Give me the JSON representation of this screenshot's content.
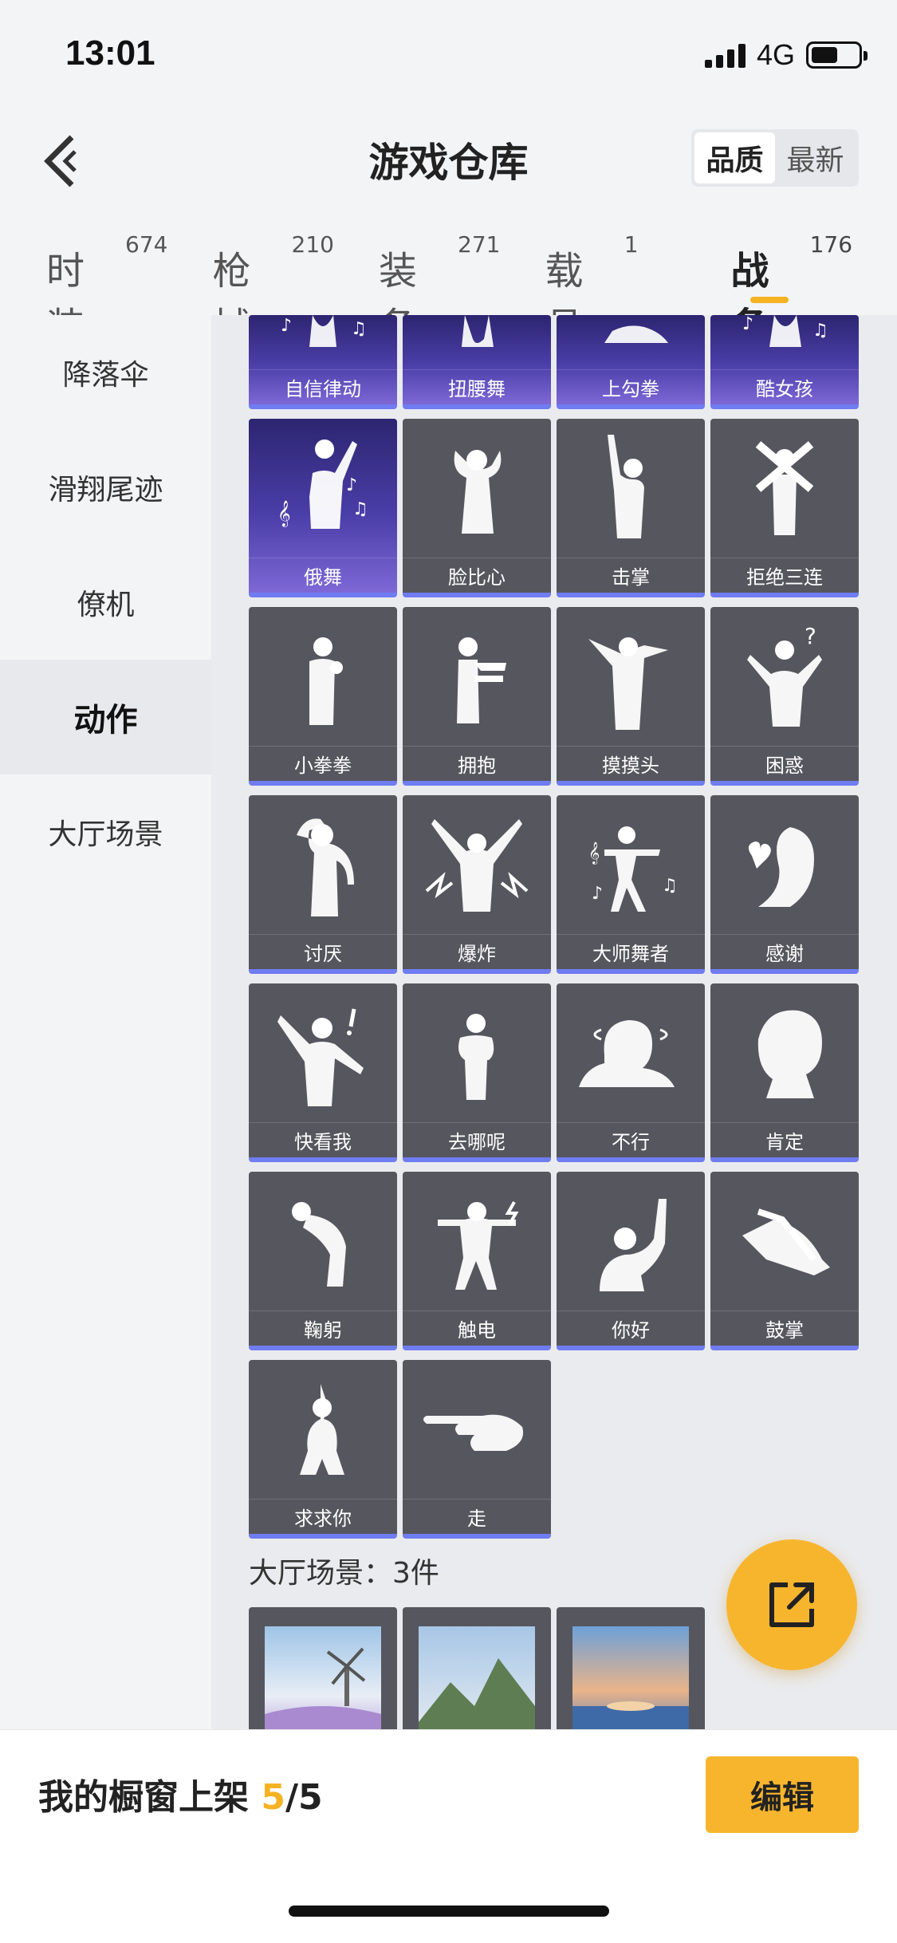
{
  "status_bar": {
    "time": "13:01",
    "network": "4G"
  },
  "header": {
    "title": "游戏仓库",
    "sort_options": [
      "品质",
      "最新"
    ],
    "active_sort": "品质"
  },
  "tabs": [
    {
      "label": "时装",
      "count": "674"
    },
    {
      "label": "枪械",
      "count": "210"
    },
    {
      "label": "装备",
      "count": "271"
    },
    {
      "label": "载具",
      "count": "1"
    },
    {
      "label": "战备",
      "count": "176"
    }
  ],
  "active_tab": "战备",
  "sidebar": {
    "items": [
      "降落伞",
      "滑翔尾迹",
      "僚机",
      "动作",
      "大厅场景"
    ],
    "active": "动作"
  },
  "actions_top_row": [
    "自信律动",
    "扭腰舞",
    "上勾拳",
    "酷女孩"
  ],
  "actions": [
    {
      "label": "俄舞",
      "icon": "dancer-music-icon",
      "rarity": "purple"
    },
    {
      "label": "脸比心",
      "icon": "heart-hands-icon",
      "rarity": "gray"
    },
    {
      "label": "击掌",
      "icon": "high-five-icon",
      "rarity": "gray"
    },
    {
      "label": "拒绝三连",
      "icon": "cross-arms-icon",
      "rarity": "gray"
    },
    {
      "label": "小拳拳",
      "icon": "fist-icon",
      "rarity": "gray"
    },
    {
      "label": "拥抱",
      "icon": "hug-icon",
      "rarity": "gray"
    },
    {
      "label": "摸摸头",
      "icon": "pat-head-icon",
      "rarity": "gray"
    },
    {
      "label": "困惑",
      "icon": "confused-icon",
      "rarity": "gray"
    },
    {
      "label": "讨厌",
      "icon": "hate-icon",
      "rarity": "gray"
    },
    {
      "label": "爆炸",
      "icon": "explode-icon",
      "rarity": "gray"
    },
    {
      "label": "大师舞者",
      "icon": "master-dancer-icon",
      "rarity": "gray"
    },
    {
      "label": "感谢",
      "icon": "thanks-icon",
      "rarity": "gray"
    },
    {
      "label": "快看我",
      "icon": "look-at-me-icon",
      "rarity": "gray"
    },
    {
      "label": "去哪呢",
      "icon": "where-icon",
      "rarity": "gray"
    },
    {
      "label": "不行",
      "icon": "no-icon",
      "rarity": "gray"
    },
    {
      "label": "肯定",
      "icon": "yes-icon",
      "rarity": "gray"
    },
    {
      "label": "鞠躬",
      "icon": "bow-icon",
      "rarity": "gray"
    },
    {
      "label": "触电",
      "icon": "shock-icon",
      "rarity": "gray"
    },
    {
      "label": "你好",
      "icon": "wave-icon",
      "rarity": "gray"
    },
    {
      "label": "鼓掌",
      "icon": "clap-icon",
      "rarity": "gray"
    },
    {
      "label": "求求你",
      "icon": "beg-icon",
      "rarity": "gray"
    },
    {
      "label": "走",
      "icon": "point-icon",
      "rarity": "gray"
    }
  ],
  "scene_section": {
    "label": "大厅场景：3件",
    "scenes": [
      "windmill-scene",
      "mountain-scene",
      "sunset-sea-scene"
    ]
  },
  "share_button": {
    "icon": "share-icon"
  },
  "bottom_bar": {
    "prefix": "我的橱窗上架 ",
    "current": "5",
    "separator": "/",
    "total": "5",
    "edit_label": "编辑"
  },
  "colors": {
    "accent": "#f7b52e",
    "card_gray": "#56565e",
    "card_purple": "#4a3ea8",
    "rarity_line": "#6f7cf2"
  }
}
